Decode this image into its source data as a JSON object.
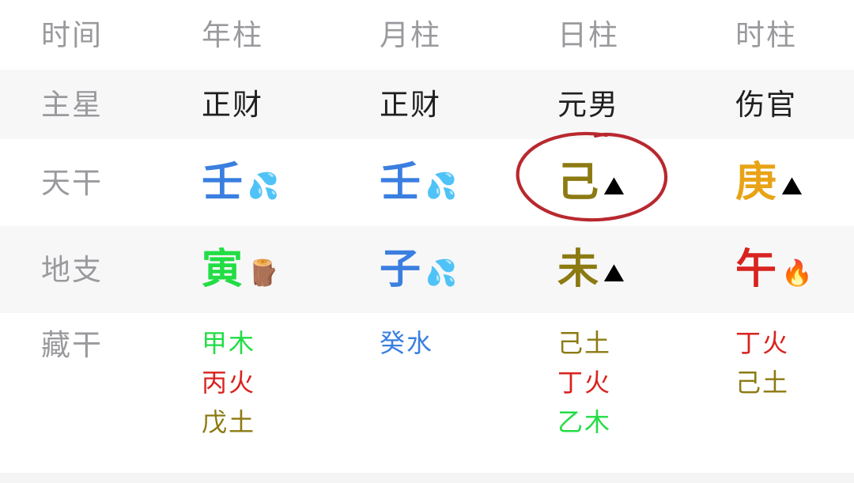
{
  "colors": {
    "label_gray": "#9a9a9e",
    "text_dark": "#1f1f1f",
    "row_shade": "#f7f7f8",
    "row_plain": "#ffffff",
    "water_blue": "#3a7fe0",
    "wood_green": "#22dd44",
    "earth_olive": "#8c7a12",
    "metal_gold": "#e8a317",
    "fire_red": "#d8231f",
    "annotation_red": "#b9282f"
  },
  "table": {
    "header_row": {
      "label": "时间",
      "columns": [
        "年柱",
        "月柱",
        "日柱",
        "时柱"
      ]
    },
    "rows": [
      {
        "name": "zhuxing",
        "label": "主星",
        "shaded": true,
        "cells": [
          {
            "text": "正财",
            "color": "#1f1f1f"
          },
          {
            "text": "正财",
            "color": "#1f1f1f"
          },
          {
            "text": "元男",
            "color": "#1f1f1f"
          },
          {
            "text": "伤官",
            "color": "#1f1f1f"
          }
        ]
      },
      {
        "name": "tiangan",
        "label": "天干",
        "shaded": false,
        "cells": [
          {
            "text": "壬",
            "color": "#3a7fe0",
            "emoji": "💦",
            "emoji_name": "water-droplets-icon",
            "element": "水"
          },
          {
            "text": "壬",
            "color": "#3a7fe0",
            "emoji": "💦",
            "emoji_name": "water-droplets-icon",
            "element": "水"
          },
          {
            "text": "己",
            "color": "#8c7a12",
            "emoji": "⛰",
            "emoji_name": "earth-mountain-icon",
            "element": "土",
            "circled": true
          },
          {
            "text": "庚",
            "color": "#e8a317",
            "emoji": "⛰",
            "emoji_name": "metal-gold-icon",
            "element": "金"
          }
        ]
      },
      {
        "name": "dizhi",
        "label": "地支",
        "shaded": true,
        "cells": [
          {
            "text": "寅",
            "color": "#22dd44",
            "emoji": "🪵",
            "emoji_name": "wood-log-icon",
            "element": "木"
          },
          {
            "text": "子",
            "color": "#3a7fe0",
            "emoji": "💦",
            "emoji_name": "water-droplets-icon",
            "element": "水"
          },
          {
            "text": "未",
            "color": "#8c7a12",
            "emoji": "⛰",
            "emoji_name": "earth-mountain-icon",
            "element": "土"
          },
          {
            "text": "午",
            "color": "#d8231f",
            "emoji": "🔥",
            "emoji_name": "fire-icon",
            "element": "火"
          }
        ]
      },
      {
        "name": "canggan",
        "label": "藏干",
        "shaded": false,
        "cells": [
          {
            "items": [
              {
                "text": "甲木",
                "color": "#22dd44"
              },
              {
                "text": "丙火",
                "color": "#d8231f"
              },
              {
                "text": "戊土",
                "color": "#8c7a12"
              }
            ]
          },
          {
            "items": [
              {
                "text": "癸水",
                "color": "#3a7fe0"
              }
            ]
          },
          {
            "items": [
              {
                "text": "己土",
                "color": "#8c7a12"
              },
              {
                "text": "丁火",
                "color": "#d8231f"
              },
              {
                "text": "乙木",
                "color": "#22dd44"
              }
            ]
          },
          {
            "items": [
              {
                "text": "丁火",
                "color": "#d8231f"
              },
              {
                "text": "己土",
                "color": "#8c7a12"
              }
            ]
          }
        ]
      }
    ]
  },
  "annotation": {
    "name": "red-circle-annotation",
    "target": "己",
    "color": "#b9282f"
  }
}
